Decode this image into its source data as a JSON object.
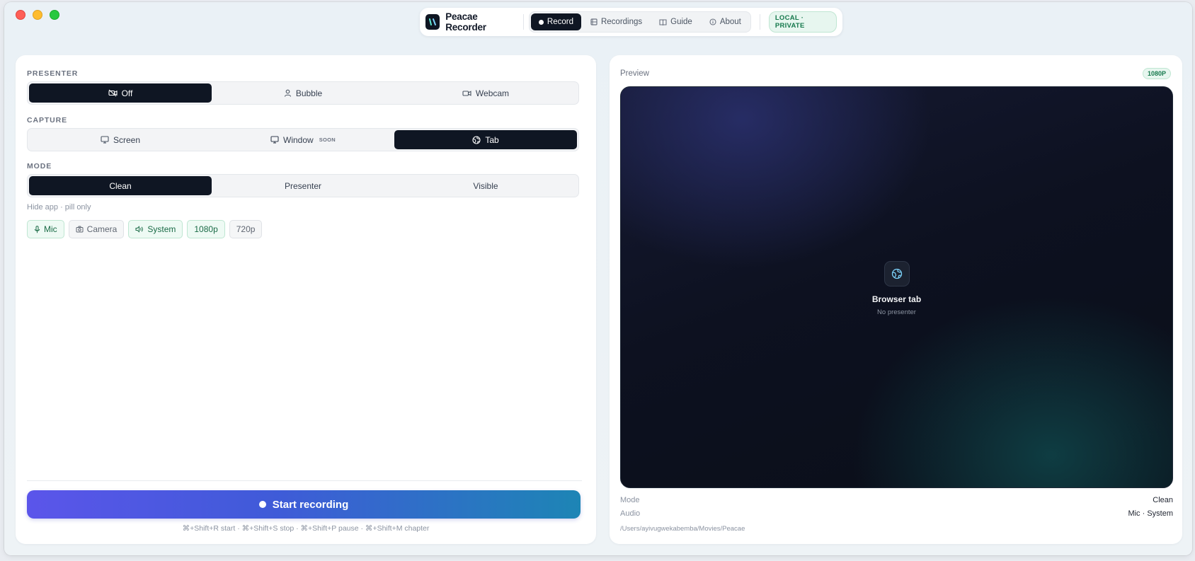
{
  "app": {
    "name": "Peacae Recorder",
    "badge": "LOCAL · PRIVATE"
  },
  "nav": [
    {
      "label": "Record",
      "icon": "record-dot-icon",
      "active": true
    },
    {
      "label": "Recordings",
      "icon": "film-icon",
      "active": false
    },
    {
      "label": "Guide",
      "icon": "book-icon",
      "active": false
    },
    {
      "label": "About",
      "icon": "info-icon",
      "active": false
    }
  ],
  "presenter": {
    "label": "PRESENTER",
    "options": [
      {
        "label": "Off",
        "icon": "video-off-icon",
        "active": true
      },
      {
        "label": "Bubble",
        "icon": "user-icon",
        "active": false
      },
      {
        "label": "Webcam",
        "icon": "video-icon",
        "active": false
      }
    ]
  },
  "capture": {
    "label": "CAPTURE",
    "options": [
      {
        "label": "Screen",
        "icon": "monitor-icon",
        "active": false
      },
      {
        "label": "Window",
        "tag": "SOON",
        "icon": "window-icon",
        "active": false
      },
      {
        "label": "Tab",
        "icon": "globe-icon",
        "active": true
      }
    ]
  },
  "mode": {
    "label": "MODE",
    "options": [
      {
        "label": "Clean",
        "active": true
      },
      {
        "label": "Presenter",
        "active": false
      },
      {
        "label": "Visible",
        "active": false
      }
    ],
    "hint": "Hide app · pill only"
  },
  "toggles": [
    {
      "label": "Mic",
      "icon": "mic-icon",
      "on": true
    },
    {
      "label": "Camera",
      "icon": "camera-icon",
      "on": false
    },
    {
      "label": "System",
      "icon": "speaker-icon",
      "on": true
    },
    {
      "label": "1080p",
      "on": true
    },
    {
      "label": "720p",
      "on": false
    }
  ],
  "start": {
    "label": "Start recording",
    "shortcuts": "⌘+Shift+R start · ⌘+Shift+S stop · ⌘+Shift+P pause · ⌘+Shift+M chapter"
  },
  "preview": {
    "title": "Preview",
    "resolution": "1080P",
    "source": "Browser tab",
    "presenter": "No presenter",
    "meta": [
      {
        "key": "Mode",
        "value": "Clean"
      },
      {
        "key": "Audio",
        "value": "Mic · System"
      }
    ],
    "path": "/Users/ayivugwekabemba/Movies/Peacae"
  },
  "colors": {
    "accent_dark": "#0f1623",
    "success": "#16794d",
    "gradient_start": "#5b55ea",
    "gradient_end": "#1d85b5"
  }
}
